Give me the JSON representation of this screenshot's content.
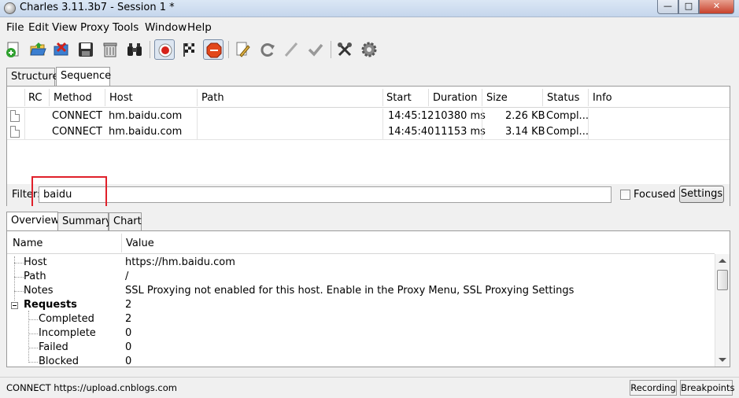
{
  "window": {
    "title": "Charles 3.11.3b7 - Session 1 *"
  },
  "menu": [
    "File",
    "Edit",
    "View",
    "Proxy",
    "Tools",
    "Window",
    "Help"
  ],
  "toolbar": {
    "icons": [
      "new-session",
      "open-session",
      "close-session",
      "save",
      "clear",
      "find",
      "record",
      "throttle",
      "breakpoints",
      "edit",
      "repeat",
      "validate",
      "tick",
      "tools",
      "settings"
    ]
  },
  "top_tabs": [
    "Structure",
    "Sequence"
  ],
  "sequence": {
    "columns": [
      "RC",
      "Method",
      "Host",
      "Path",
      "Start",
      "Duration",
      "Size",
      "Status",
      "Info"
    ],
    "rows": [
      {
        "rc": "",
        "method": "CONNECT",
        "host": "hm.baidu.com",
        "path": "",
        "start": "14:45:12",
        "duration": "10380 ms",
        "size": "2.26 KB",
        "status": "Compl...",
        "info": ""
      },
      {
        "rc": "",
        "method": "CONNECT",
        "host": "hm.baidu.com",
        "path": "",
        "start": "14:45:40",
        "duration": "11153 ms",
        "size": "3.14 KB",
        "status": "Compl...",
        "info": ""
      }
    ]
  },
  "filter": {
    "label": "Filter:",
    "value": "baidu",
    "focused_label": "Focused",
    "focused_checked": false,
    "settings_label": "Settings"
  },
  "bottom_tabs": [
    "Overview",
    "Summary",
    "Chart"
  ],
  "overview": {
    "columns": [
      "Name",
      "Value"
    ],
    "rows": [
      {
        "name": "Host",
        "value": "https://hm.baidu.com"
      },
      {
        "name": "Path",
        "value": "/"
      },
      {
        "name": "Notes",
        "value": "SSL Proxying not enabled for this host. Enable in the Proxy Menu, SSL Proxying Settings"
      },
      {
        "name": "Requests",
        "value": "2"
      },
      {
        "name": "Completed",
        "value": "2"
      },
      {
        "name": "Incomplete",
        "value": "0"
      },
      {
        "name": "Failed",
        "value": "0"
      },
      {
        "name": "Blocked",
        "value": "0"
      }
    ]
  },
  "status": {
    "text": "CONNECT https://upload.cnblogs.com",
    "recording_label": "Recording",
    "breakpoints_label": "Breakpoints"
  },
  "colors": {
    "highlight": "#e0202a"
  }
}
